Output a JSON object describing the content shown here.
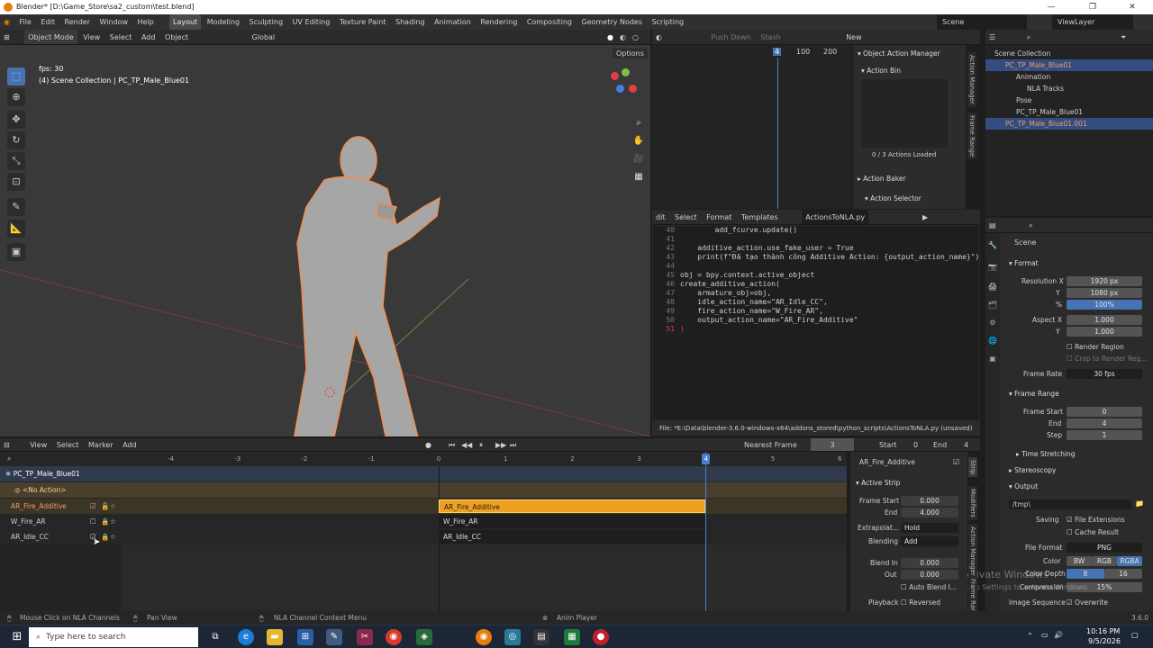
{
  "window": {
    "title": "Blender* [D:\\Game_Store\\sa2_custom\\test.blend]"
  },
  "menu": {
    "items": [
      "File",
      "Edit",
      "Render",
      "Window",
      "Help"
    ]
  },
  "workspaces": [
    "Layout",
    "Modeling",
    "Sculpting",
    "UV Editing",
    "Texture Paint",
    "Shading",
    "Animation",
    "Rendering",
    "Compositing",
    "Geometry Nodes",
    "Scripting"
  ],
  "scene": {
    "label": "Scene",
    "view_layer": "ViewLayer"
  },
  "viewport": {
    "mode": "Object Mode",
    "menus": [
      "View",
      "Select",
      "Add",
      "Object"
    ],
    "transform": "Global",
    "options": "Options",
    "fps": "fps: 30",
    "collection_info": "(4) Scene Collection | PC_TP_Male_Blue01"
  },
  "action_editor": {
    "push_down": "Push Down",
    "stash": "Stash",
    "new": "New",
    "frame_start_num": "4",
    "num_100": "100",
    "num_200": "200",
    "manager_title": "Object Action Manager",
    "action_bin": "Action Bin",
    "actions_loaded": "0 / 3 Actions Loaded",
    "action_baker": "Action Baker",
    "action_selector": "Action Selector",
    "side_tabs": [
      "Action Manager",
      "Frame Range"
    ]
  },
  "text_editor": {
    "menus": [
      "dit",
      "Select",
      "Format",
      "Templates"
    ],
    "filename": "ActionsToNLA.py",
    "lines": [
      {
        "n": "40",
        "t": "        add_fcurve.update()"
      },
      {
        "n": "41",
        "t": ""
      },
      {
        "n": "42",
        "t": "    additive_action.use_fake_user = True"
      },
      {
        "n": "43",
        "t": "    print(f\"Đã tạo thành công Additive Action: {output_action_name}\")"
      },
      {
        "n": "44",
        "t": ""
      },
      {
        "n": "45",
        "t": "obj = bpy.context.active_object"
      },
      {
        "n": "46",
        "t": "create_additive_action("
      },
      {
        "n": "47",
        "t": "    armature_obj=obj,"
      },
      {
        "n": "48",
        "t": "    idle_action_name=\"AR_Idle_CC\","
      },
      {
        "n": "49",
        "t": "    fire_action_name=\"W_Fire_AR\","
      },
      {
        "n": "50",
        "t": "    output_action_name=\"AR_Fire_Additive\""
      },
      {
        "n": "51",
        "t": ")"
      }
    ],
    "footer": "File: *E:\\Data\\blender-3.6.0-windows-x64\\addons_stored\\python_scripts\\ActionsToNLA.py (unsaved)"
  },
  "outliner": {
    "rows": [
      {
        "label": "Scene Collection",
        "indent": 0
      },
      {
        "label": "PC_TP_Male_Blue01",
        "indent": 1
      },
      {
        "label": "Animation",
        "indent": 2
      },
      {
        "label": "NLA Tracks",
        "indent": 3
      },
      {
        "label": "Pose",
        "indent": 2
      },
      {
        "label": "PC_TP_Male_Blue01",
        "indent": 2
      },
      {
        "label": "PC_TP_Male_Blue01.001",
        "indent": 1
      }
    ]
  },
  "properties": {
    "scene": "Scene",
    "format": "Format",
    "res_x_label": "Resolution X",
    "res_x": "1920 px",
    "res_y_label": "Y",
    "res_y": "1080 px",
    "pct_label": "%",
    "pct": "100%",
    "aspect_x_label": "Aspect X",
    "aspect_x": "1.000",
    "aspect_y_label": "Y",
    "aspect_y": "1.000",
    "render_region": "Render Region",
    "crop": "Crop to Render Reg...",
    "frame_rate_label": "Frame Rate",
    "frame_rate": "30 fps",
    "frame_range": "Frame Range",
    "frame_start_label": "Frame Start",
    "frame_start": "0",
    "end_label": "End",
    "end": "4",
    "step_label": "Step",
    "step": "1",
    "time_stretching": "Time Stretching",
    "stereoscopy": "Stereoscopy",
    "output": "Output",
    "path": "/tmp\\",
    "saving": "Saving",
    "file_ext": "File Extensions",
    "cache_result": "Cache Result",
    "file_format_label": "File Format",
    "file_format": "PNG",
    "color_label": "Color",
    "color_opts": [
      "BW",
      "RGB",
      "RGBA"
    ],
    "depth_label": "Color Depth",
    "depth_opts": [
      "8",
      "16"
    ],
    "compression_label": "Compression",
    "compression": "15%",
    "image_seq": "Image Sequence",
    "overwrite": "Overwrite",
    "activate1": "Activate Windows",
    "activate2": "Go to Settings to activate Windows."
  },
  "nla": {
    "menus": [
      "View",
      "Select",
      "Marker",
      "Add"
    ],
    "snap": "Nearest Frame",
    "current_frame": "3",
    "start_label": "Start",
    "start": "0",
    "end_label": "End",
    "end": "4",
    "ticks": [
      "-4",
      "-3",
      "-2",
      "-1",
      "0",
      "1",
      "2",
      "3",
      "4",
      "5",
      "6"
    ],
    "object": "PC_TP_Male_Blue01",
    "no_action": "<No Action>",
    "tracks": [
      "AR_Fire_Additive",
      "W_Fire_AR",
      "AR_Idle_CC"
    ],
    "strip_panel": {
      "name": "AR_Fire_Additive",
      "active_strip": "Active Strip",
      "fs_label": "Frame Start",
      "fs": "0.000",
      "end_label": "End",
      "end": "4.000",
      "extrap_label": "Extrapolat...",
      "extrap": "Hold",
      "blending_label": "Blending",
      "blending": "Add",
      "blend_in_label": "Blend In",
      "blend_in": "0.000",
      "out_label": "Out",
      "out": "0.000",
      "auto_blend": "Auto Blend I...",
      "playback_label": "Playback",
      "reversed": "Reversed",
      "tabs": [
        "Strip",
        "Modifiers",
        "Action Manager",
        "Frame Range"
      ]
    }
  },
  "status_bar": {
    "items": [
      "Mouse Click on NLA Channels",
      "Pan View",
      "NLA Channel Context Menu",
      "Anim Player"
    ],
    "version": "3.6.0"
  },
  "taskbar": {
    "search": "Type here to search",
    "time": "10:16 PM",
    "date": "9/5/2026"
  },
  "colors": {
    "accent": "#4772b3",
    "strip_active": "#f0a020",
    "selected_text": "#f09d6a",
    "playhead": "#4a7fd0"
  }
}
